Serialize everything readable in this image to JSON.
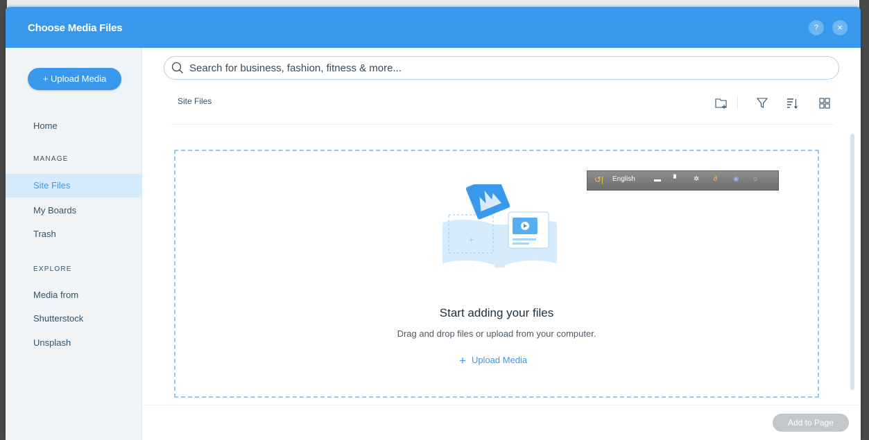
{
  "header": {
    "title": "Choose Media Files",
    "help_glyph": "?",
    "close_glyph": "×"
  },
  "sidebar": {
    "upload_label": "+ Upload Media",
    "home": "Home",
    "manage_heading": "MANAGE",
    "manage_items": [
      "Site Files",
      "My Boards",
      "Trash"
    ],
    "explore_heading": "EXPLORE",
    "explore_items": [
      "Media from",
      "Shutterstock",
      "Unsplash"
    ],
    "active_item": "Site Files"
  },
  "search": {
    "placeholder": "Search for business, fashion, fitness & more..."
  },
  "breadcrumb": "Site Files",
  "toolbar": {
    "icons": [
      "new-folder-icon",
      "filter-icon",
      "sort-icon",
      "grid-view-icon"
    ]
  },
  "empty_state": {
    "title": "Start adding your files",
    "subtitle": "Drag and drop files or upload from your computer.",
    "upload_link": "Upload Media",
    "upload_plus": "+"
  },
  "overlay_toolbar": {
    "language": "English"
  },
  "footer": {
    "add_button": "Add to Page"
  },
  "colors": {
    "accent": "#3899ec",
    "active_bg": "#d6ebfc",
    "sidebar_bg": "#f0f4f7",
    "disabled": "#c2c7cb"
  }
}
